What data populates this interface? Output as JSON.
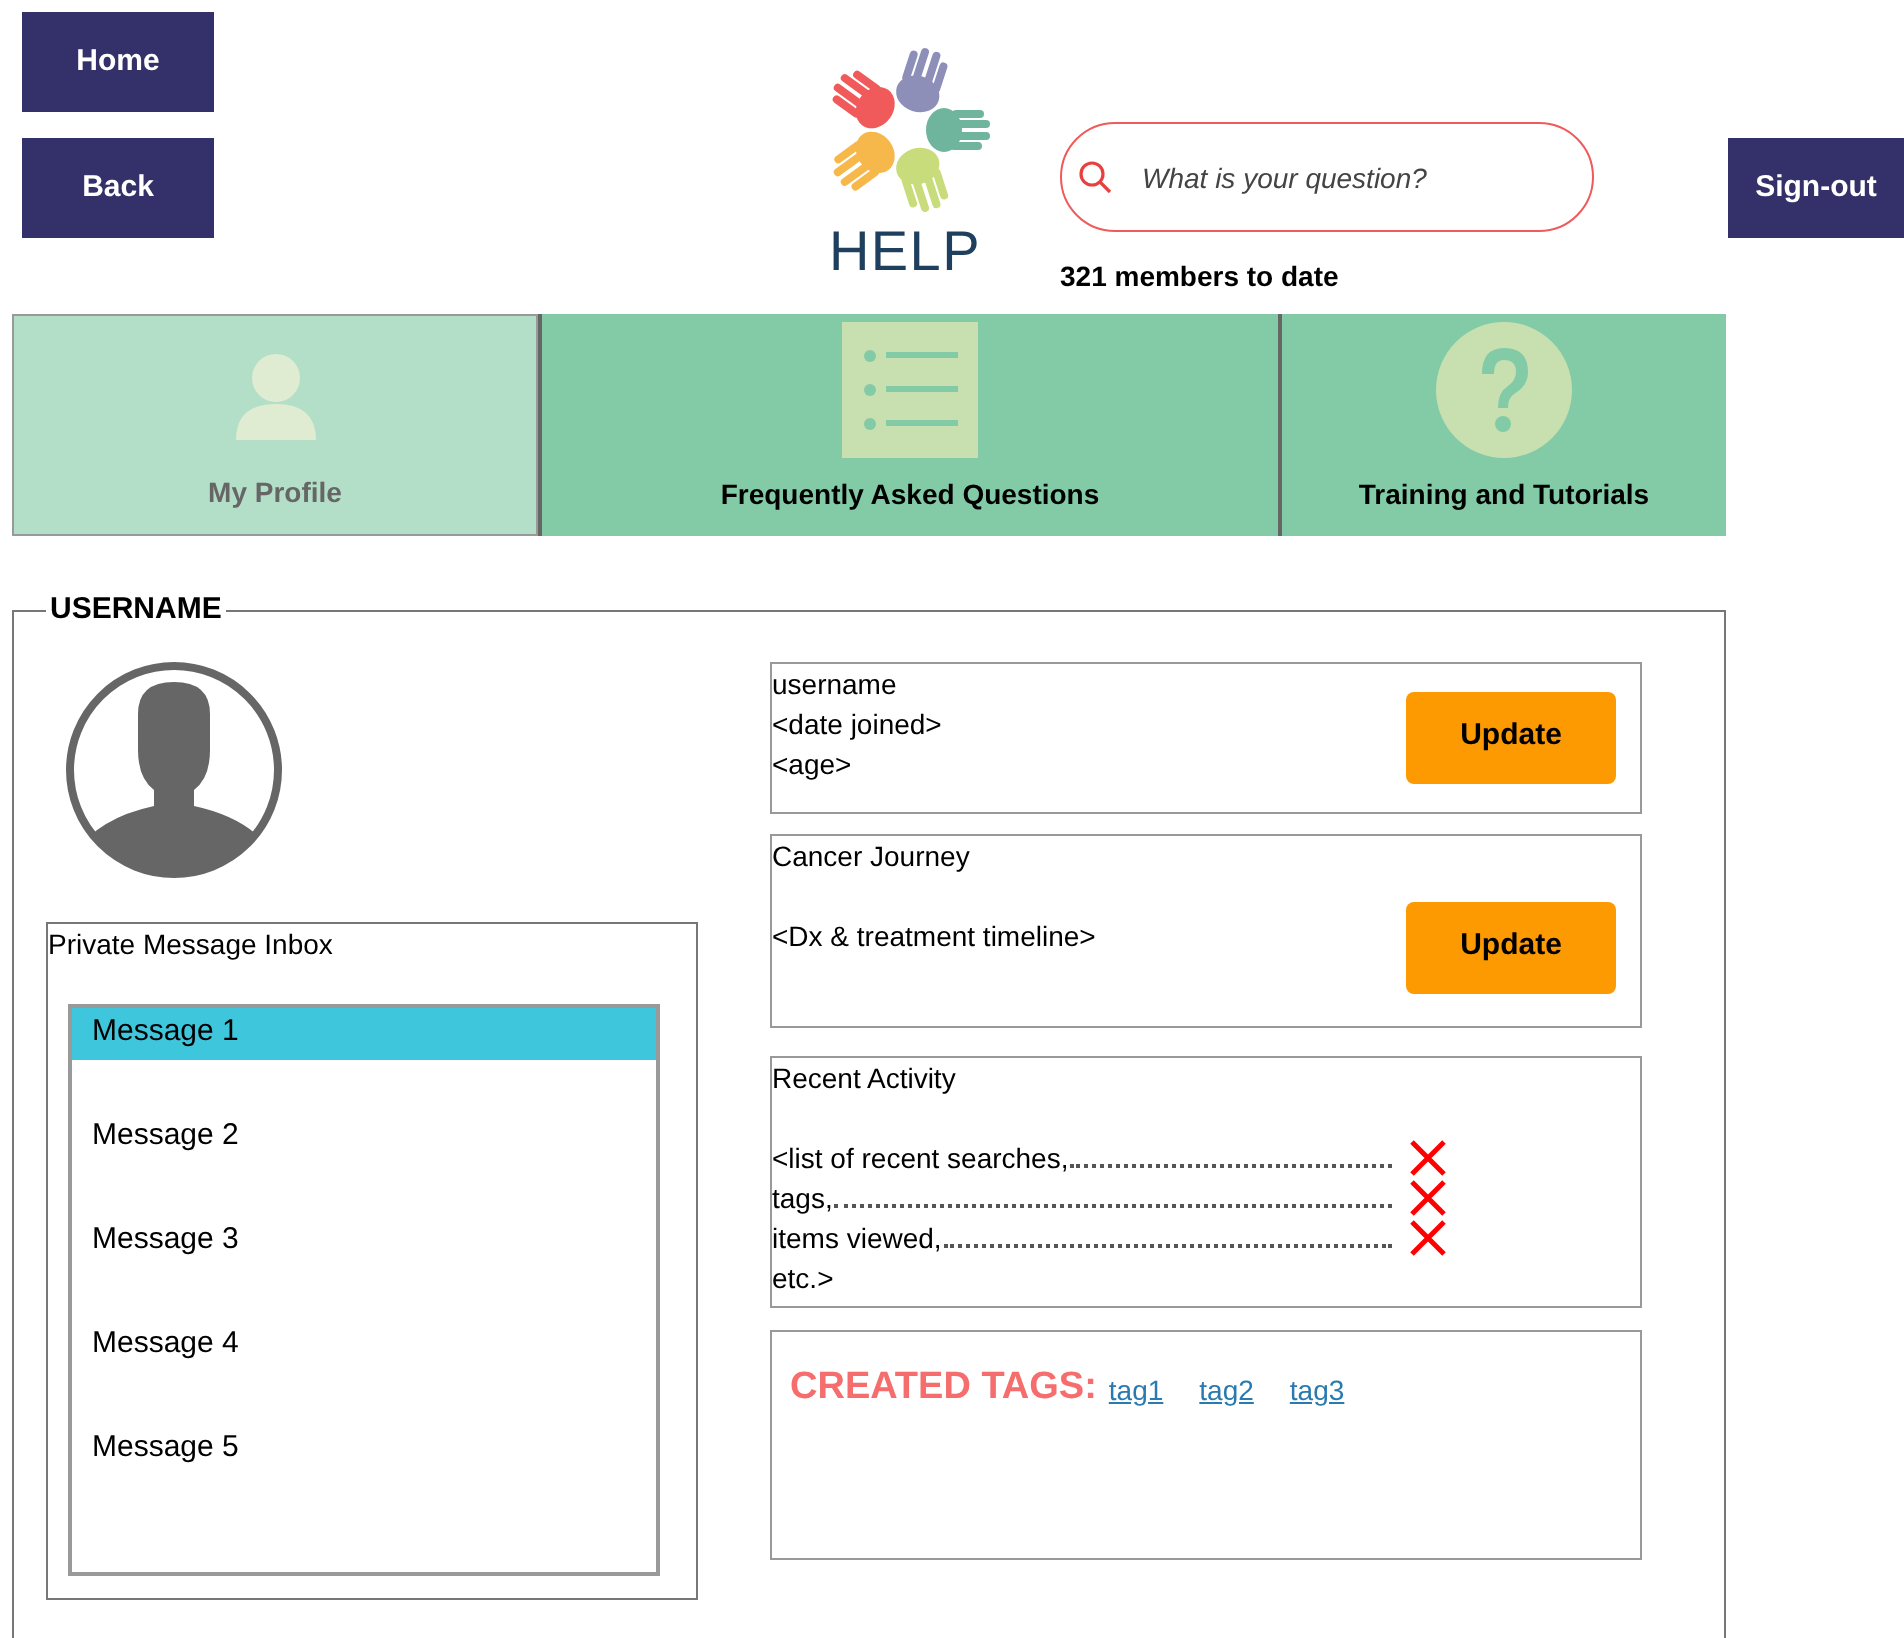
{
  "nav_buttons": [
    {
      "label": "Home"
    },
    {
      "label": "Back"
    }
  ],
  "logo": {
    "text": "HELP"
  },
  "search": {
    "placeholder": "What is your question?"
  },
  "member_count": "321 members to date",
  "signout": {
    "label": "Sign-out"
  },
  "tabs": [
    {
      "label": "My Profile",
      "kind": "person",
      "selected": true
    },
    {
      "label": "Frequently Asked Questions",
      "kind": "list",
      "selected": false
    },
    {
      "label": "Training and Tutorials",
      "kind": "question",
      "selected": false
    }
  ],
  "profile": {
    "legend": "USERNAME",
    "inbox": {
      "title": "Private Message Inbox",
      "messages": [
        {
          "label": "Message 1",
          "selected": true
        },
        {
          "label": "Message 2",
          "selected": false
        },
        {
          "label": "Message 3",
          "selected": false
        },
        {
          "label": "Message 4",
          "selected": false
        },
        {
          "label": "Message 5",
          "selected": false
        }
      ]
    },
    "info": {
      "lines": [
        "username",
        "<date joined>",
        "<age>"
      ],
      "button": "Update"
    },
    "journey": {
      "title": "Cancer Journey",
      "text": "<Dx & treatment timeline>",
      "button": "Update"
    },
    "activity": {
      "title": "Recent Activity",
      "items": [
        {
          "text": "<list of recent searches,"
        },
        {
          "text": "tags,"
        },
        {
          "text": "items viewed,"
        }
      ],
      "last": "etc.>"
    },
    "tags": {
      "label": "CREATED TAGS:",
      "items": [
        "tag1",
        "tag2",
        "tag3"
      ]
    }
  }
}
